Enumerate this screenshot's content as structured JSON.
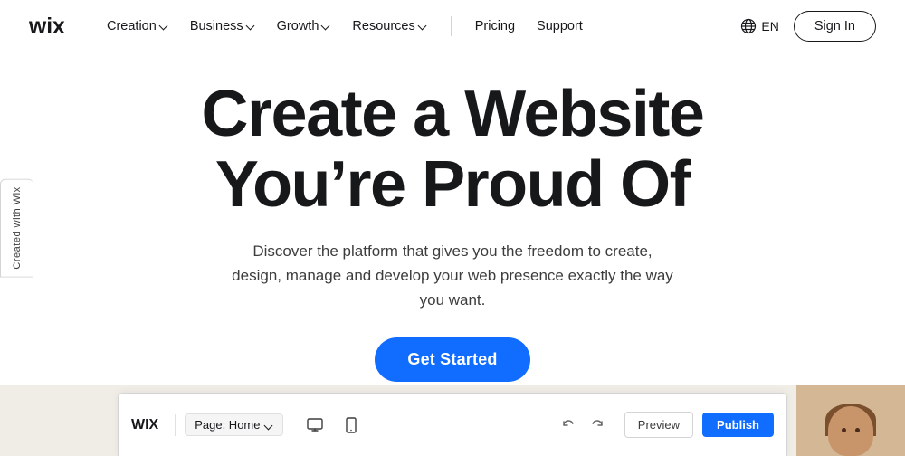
{
  "nav": {
    "logo_alt": "Wix",
    "links": [
      {
        "label": "Creation",
        "has_dropdown": true
      },
      {
        "label": "Business",
        "has_dropdown": true
      },
      {
        "label": "Growth",
        "has_dropdown": true
      },
      {
        "label": "Resources",
        "has_dropdown": true
      }
    ],
    "plain_links": [
      {
        "label": "Pricing"
      },
      {
        "label": "Support"
      }
    ],
    "lang": "EN",
    "signin_label": "Sign In"
  },
  "hero": {
    "title_line1": "Create a Website",
    "title_line2": "You’re Proud Of",
    "subtitle": "Discover the platform that gives you the freedom to create, design, manage and develop your web presence exactly the way you want.",
    "cta_label": "Get Started"
  },
  "side_badge": {
    "text": "Created with Wix"
  },
  "editor_bar": {
    "wix_label": "WIX",
    "page_label": "Page: Home",
    "preview_label": "Preview",
    "publish_label": "Publish"
  },
  "colors": {
    "accent": "#116dff",
    "text_dark": "#17181a",
    "text_mid": "#3d3d3d",
    "border": "#e0e0e0"
  }
}
